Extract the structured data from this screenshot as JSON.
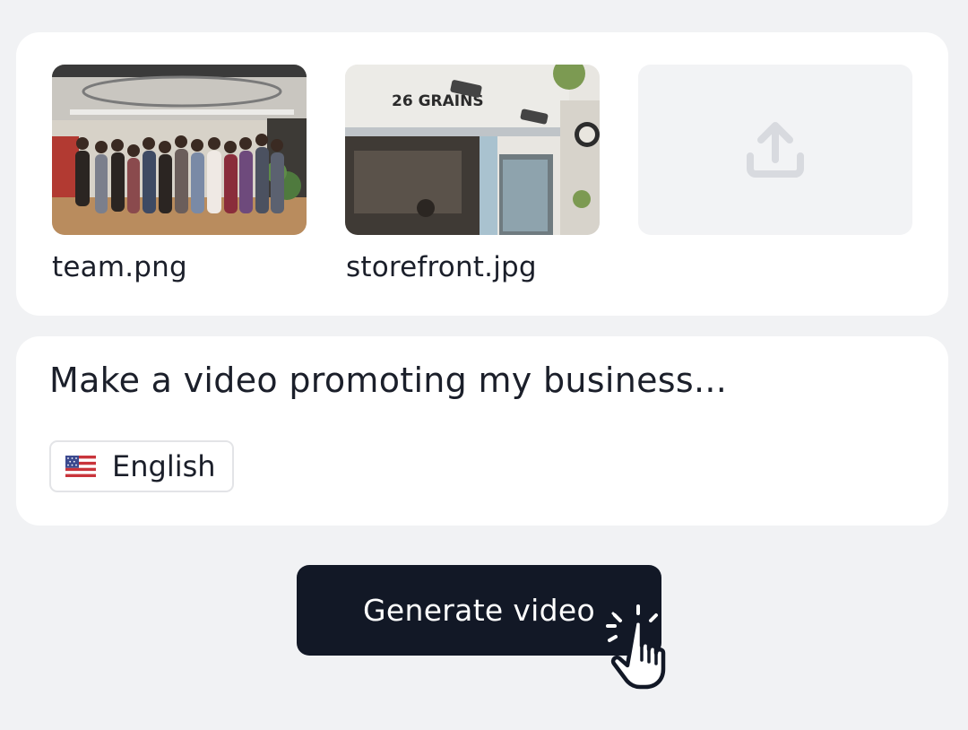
{
  "uploads": {
    "files": [
      {
        "name": "team.png"
      },
      {
        "name": "storefront.jpg",
        "sign_text": "26 GRAINS"
      }
    ],
    "upload_icon": "upload-icon"
  },
  "prompt": {
    "text": "Make a video promoting my business..."
  },
  "language": {
    "flag_icon": "us-flag-icon",
    "label": "English"
  },
  "actions": {
    "generate_label": "Generate video"
  },
  "colors": {
    "background": "#f1f2f4",
    "card": "#ffffff",
    "button": "#121826",
    "button_text": "#ffffff",
    "upload_slot": "#f2f3f5"
  }
}
